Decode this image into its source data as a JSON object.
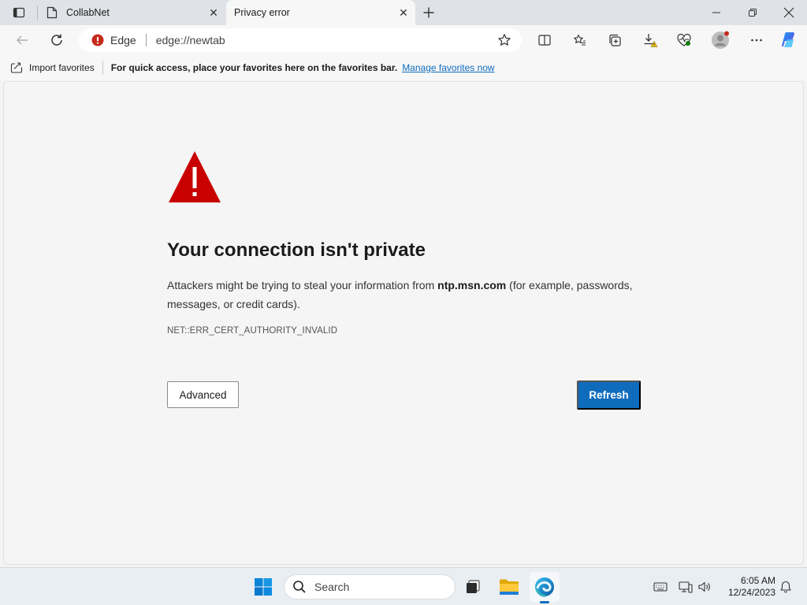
{
  "tabs": [
    {
      "title": "CollabNet",
      "icon": "page-icon"
    },
    {
      "title": "Privacy error",
      "active": true
    }
  ],
  "address_bar": {
    "brand": "Edge",
    "url": "edge://newtab"
  },
  "favorites_bar": {
    "import_label": "Import favorites",
    "message": "For quick access, place your favorites here on the favorites bar.",
    "manage_link": "Manage favorites now"
  },
  "error_page": {
    "title": "Your connection isn't private",
    "desc_prefix": "Attackers might be trying to steal your information from ",
    "host": "ntp.msn.com",
    "desc_suffix": " (for example, passwords, messages, or credit cards).",
    "error_code": "NET::ERR_CERT_AUTHORITY_INVALID",
    "advanced_button": "Advanced",
    "refresh_button": "Refresh"
  },
  "taskbar": {
    "search_label": "Search",
    "time": "6:05 AM",
    "date": "12/24/2023"
  },
  "colors": {
    "accent": "#0f6cbd",
    "warning_red": "#c80000"
  }
}
